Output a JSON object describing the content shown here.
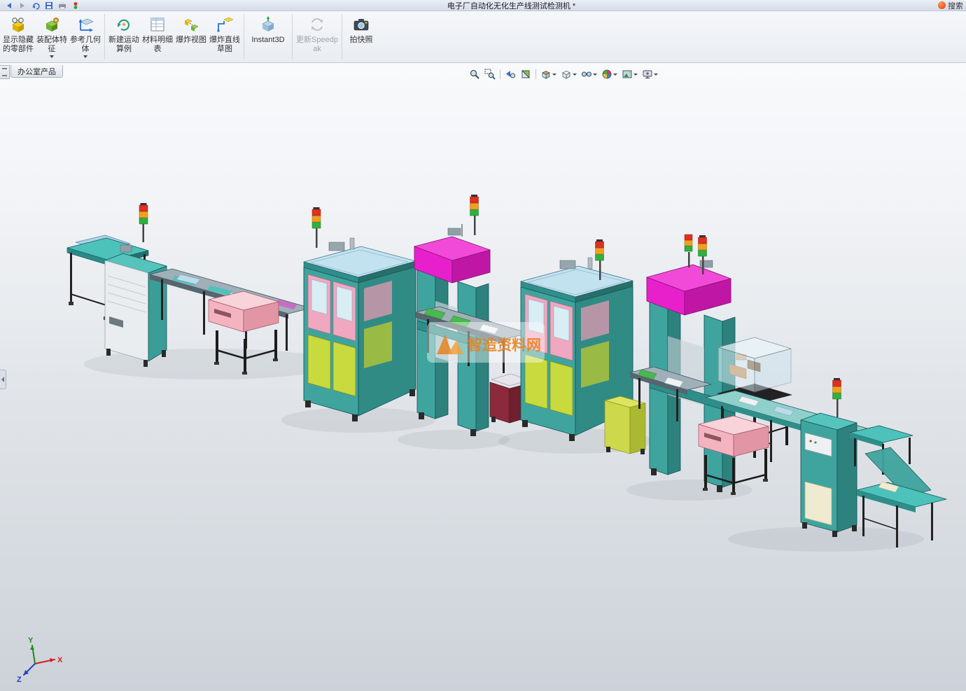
{
  "window": {
    "title": "电子厂自动化无化生产线测试检测机 *"
  },
  "titlebar": {
    "search_label": "搜索"
  },
  "quick_access": {
    "icons": [
      "back",
      "forward",
      "undo",
      "save",
      "print",
      "rebuild"
    ]
  },
  "toolbar": {
    "buttons": [
      {
        "label": "显示隐藏的零部件",
        "dropdown": false,
        "enabled": true
      },
      {
        "label": "装配体特征",
        "dropdown": true,
        "enabled": true
      },
      {
        "label": "参考几何体",
        "dropdown": true,
        "enabled": true
      },
      {
        "label": "新建运动算例",
        "dropdown": false,
        "enabled": true
      },
      {
        "label": "材料明细表",
        "dropdown": false,
        "enabled": true
      },
      {
        "label": "爆炸视图",
        "dropdown": false,
        "enabled": true
      },
      {
        "label": "爆炸直线草图",
        "dropdown": false,
        "enabled": true
      },
      {
        "label": "Instant3D",
        "dropdown": false,
        "enabled": true
      },
      {
        "label": "更新Speedpak",
        "dropdown": false,
        "enabled": false
      },
      {
        "label": "拍快照",
        "dropdown": false,
        "enabled": true
      }
    ]
  },
  "left_tab": {
    "label": "办公室产品"
  },
  "headsup": {
    "buttons": [
      "zoom-to-fit",
      "zoom-to-area",
      "previous-view",
      "section-view",
      "view-orientation",
      "display-style",
      "hide-show-items",
      "edit-appearance",
      "apply-scene",
      "view-settings"
    ]
  },
  "viewport": {
    "watermark": "智造资料网",
    "triad": {
      "x": "X",
      "y": "Y",
      "z": "Z"
    }
  },
  "palette": {
    "teal": "#3fa49e",
    "magenta": "#e820cc",
    "yellow_green": "#c8da3e",
    "pink_door": "#f0a8c0",
    "top_panel_blue": "#c3e2f0",
    "background_top": "#fbfcfd",
    "background_bottom": "#c9cfd7"
  }
}
